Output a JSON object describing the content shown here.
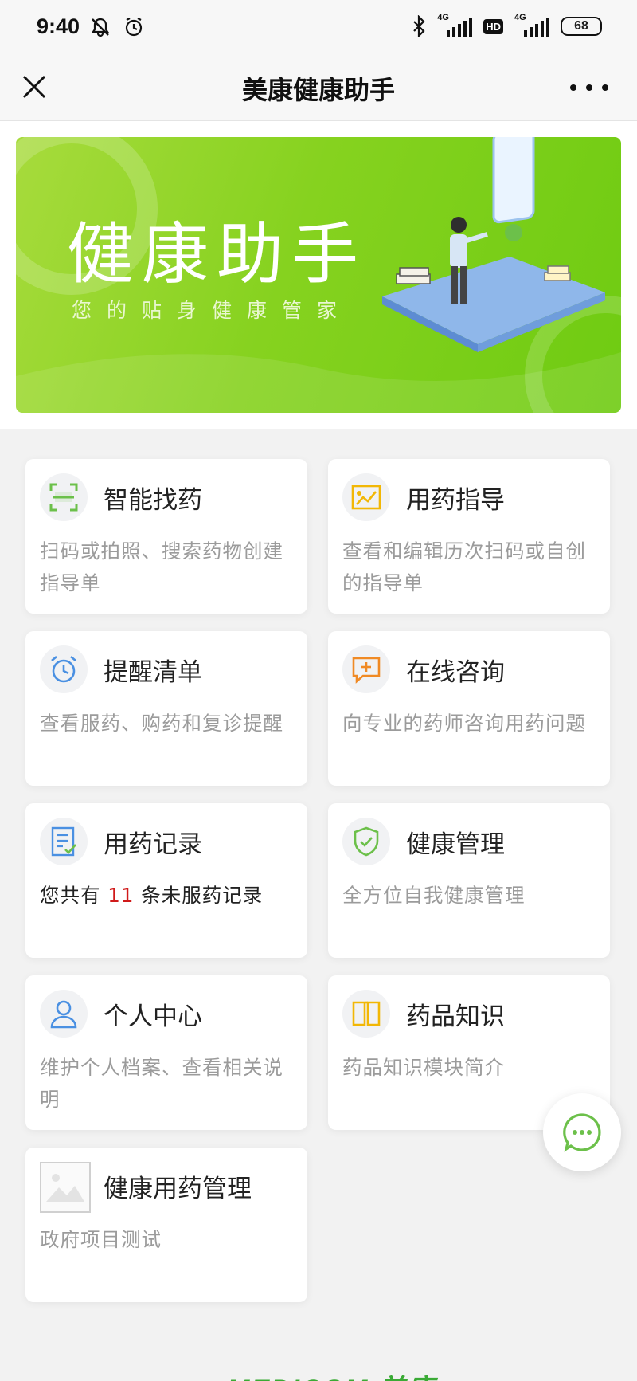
{
  "status_bar": {
    "time": "9:40",
    "network_1": "4G",
    "hd": "HD",
    "network_2": "4G",
    "battery": "68"
  },
  "header": {
    "title": "美康健康助手"
  },
  "banner": {
    "title": "健康助手",
    "subtitle": "您的贴身健康管家"
  },
  "cards": [
    {
      "title": "智能找药",
      "desc": "扫码或拍照、搜索药物创建指导单",
      "icon": "scan-icon"
    },
    {
      "title": "用药指导",
      "desc": "查看和编辑历次扫码或自创的指导单",
      "icon": "guide-icon"
    },
    {
      "title": "提醒清单",
      "desc": "查看服药、购药和复诊提醒",
      "icon": "alarm-clock-icon"
    },
    {
      "title": "在线咨询",
      "desc": "向专业的药师咨询用药问题",
      "icon": "chat-plus-icon"
    },
    {
      "title": "用药记录",
      "desc_prefix": "您共有",
      "desc_count": "11",
      "desc_suffix": "条未服药记录",
      "icon": "checklist-icon"
    },
    {
      "title": "健康管理",
      "desc": "全方位自我健康管理",
      "icon": "shield-check-icon"
    },
    {
      "title": "个人中心",
      "desc": "维护个人档案、查看相关说明",
      "icon": "user-icon"
    },
    {
      "title": "药品知识",
      "desc": "药品知识模块简介",
      "icon": "book-icon"
    },
    {
      "title": "健康用药管理",
      "desc": "政府项目测试",
      "icon": "image-placeholder-icon"
    }
  ],
  "footer": {
    "logo": "MEDICOM 美康"
  },
  "colors": {
    "banner_green": "#86d21f",
    "accent_green": "#6cc04a",
    "highlight_red": "#d01a1a",
    "icon_blue": "#4a90e2",
    "icon_yellow": "#f2b705",
    "icon_orange": "#f08a24"
  }
}
